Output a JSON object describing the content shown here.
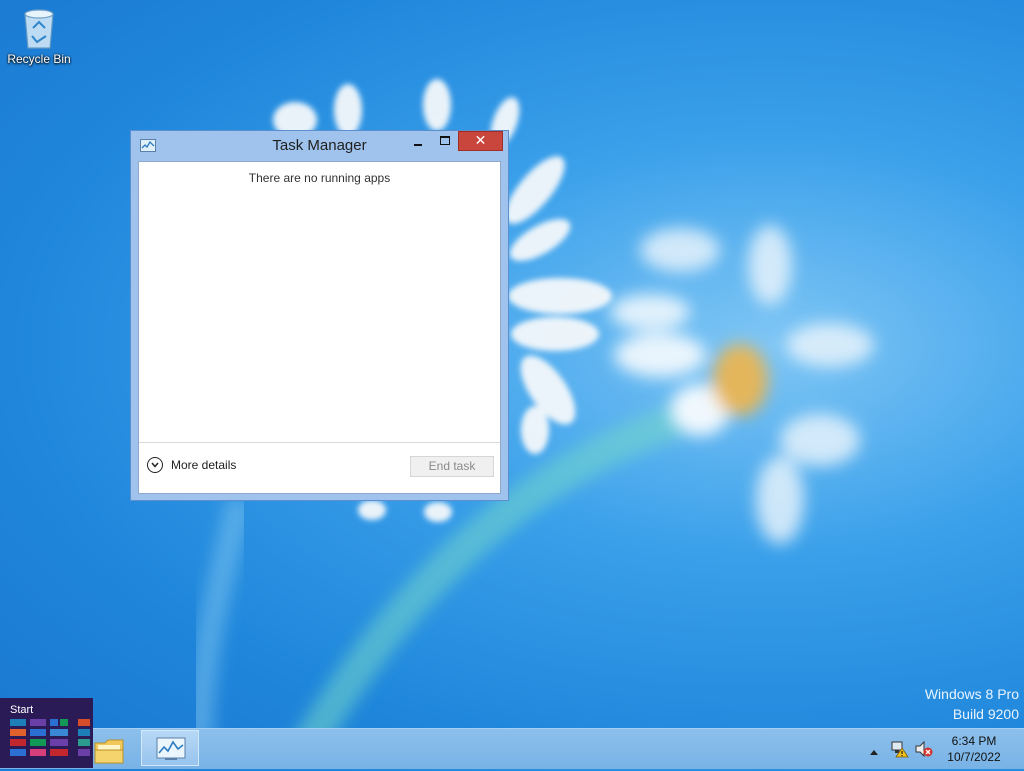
{
  "desktop": {
    "icons": [
      {
        "label": "Recycle Bin",
        "icon": "recycle-bin-icon"
      }
    ],
    "watermark": {
      "line1": "Windows 8 Pro",
      "line2": "Build 9200"
    }
  },
  "task_manager": {
    "title": "Task Manager",
    "empty_message": "There are no running apps",
    "more_details_label": "More details",
    "end_task_label": "End task",
    "close_glyph": "✕",
    "colors": {
      "close_button": "#c9463d",
      "frame": "#9fc3ec"
    }
  },
  "taskbar": {
    "start_label": "Start",
    "pinned": [
      {
        "name": "File Explorer",
        "icon": "file-explorer-icon"
      },
      {
        "name": "Task Manager",
        "icon": "task-manager-icon",
        "active": true
      }
    ],
    "tray": {
      "icons": [
        "show-hidden-icons-arrow",
        "network-warning-icon",
        "volume-muted-icon"
      ],
      "time": "6:34 PM",
      "date": "10/7/2022"
    }
  }
}
